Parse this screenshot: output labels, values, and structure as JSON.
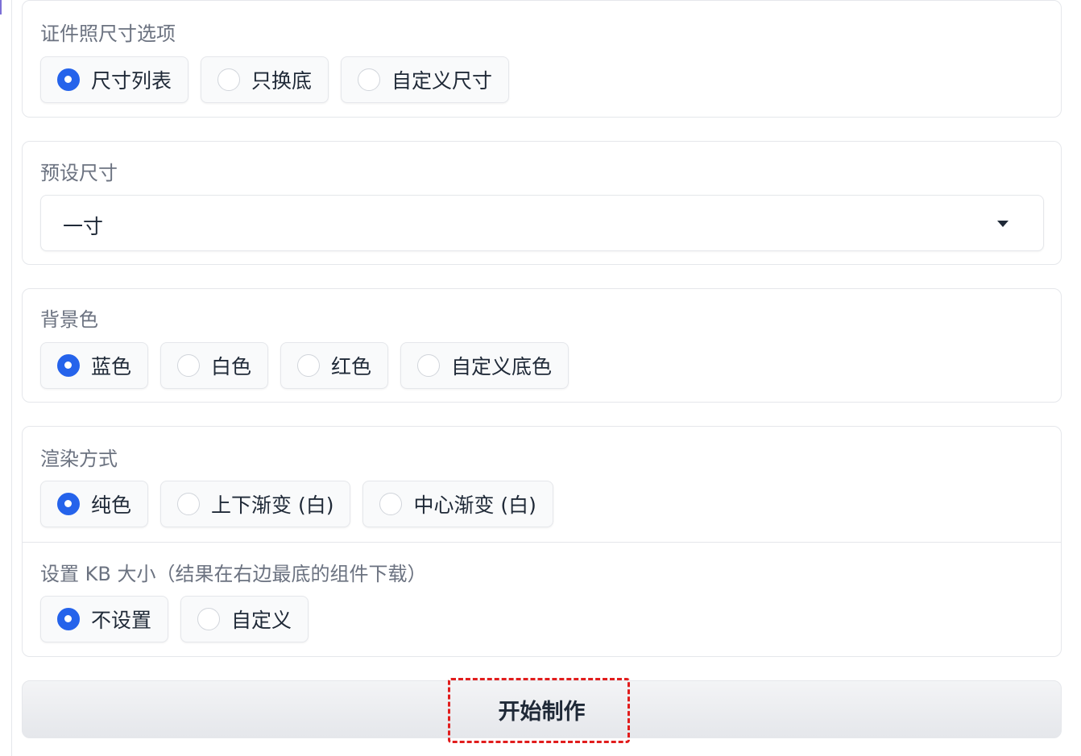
{
  "id_photo_options": {
    "label": "证件照尺寸选项",
    "options": [
      {
        "label": "尺寸列表",
        "checked": true
      },
      {
        "label": "只换底",
        "checked": false
      },
      {
        "label": "自定义尺寸",
        "checked": false
      }
    ]
  },
  "preset_size": {
    "label": "预设尺寸",
    "value": "一寸"
  },
  "background_color": {
    "label": "背景色",
    "options": [
      {
        "label": "蓝色",
        "checked": true
      },
      {
        "label": "白色",
        "checked": false
      },
      {
        "label": "红色",
        "checked": false
      },
      {
        "label": "自定义底色",
        "checked": false
      }
    ]
  },
  "render_mode": {
    "label": "渲染方式",
    "options": [
      {
        "label": "纯色",
        "checked": true
      },
      {
        "label": "上下渐变 (白)",
        "checked": false
      },
      {
        "label": "中心渐变 (白)",
        "checked": false
      }
    ]
  },
  "kb_size": {
    "label": "设置 KB 大小（结果在右边最底的组件下载）",
    "options": [
      {
        "label": "不设置",
        "checked": true
      },
      {
        "label": "自定义",
        "checked": false
      }
    ]
  },
  "start_button": {
    "label": "开始制作"
  },
  "colors": {
    "accent": "#2563eb",
    "highlight": "#e11d1d"
  }
}
